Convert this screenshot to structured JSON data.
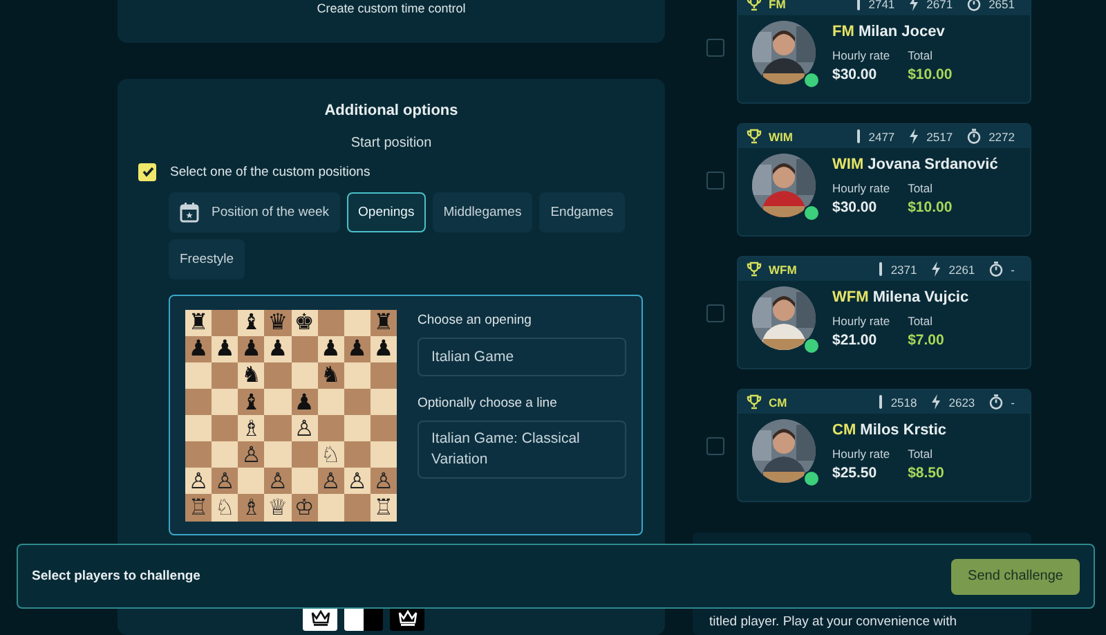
{
  "time_control": {
    "link": "Create custom time control"
  },
  "options": {
    "title": "Additional options",
    "start_position_label": "Start position",
    "custom_positions": {
      "label": "Select one of the custom positions",
      "checked": true
    },
    "categories": [
      {
        "label": "Position of the week",
        "selected": false
      },
      {
        "label": "Openings",
        "selected": true
      },
      {
        "label": "Middlegames",
        "selected": false
      },
      {
        "label": "Endgames",
        "selected": false
      },
      {
        "label": "Freestyle",
        "selected": false
      }
    ],
    "board": [
      "♜ ♝♛♚  ♜",
      "♟♟♟♟ ♟♟♟",
      "  ♞  ♞  ",
      "  ♝ ♟   ",
      "  ♗ ♙   ",
      "  ♙  ♘  ",
      "♙♙ ♙ ♙♙♙",
      "♖♘♗♕♔  ♖"
    ],
    "opening": {
      "label": "Choose an opening",
      "value": "Italian Game"
    },
    "line": {
      "label": "Optionally choose a line",
      "value": "Italian Game: Classical Variation"
    }
  },
  "players": [
    {
      "badge": "FM",
      "bullet": "2741",
      "blitz": "2671",
      "rapid": "2651",
      "title": "FM",
      "name": "Milan Jocev",
      "rate_label": "Hourly rate",
      "rate": "$30.00",
      "total_label": "Total",
      "total": "$10.00",
      "online": true,
      "selected": false
    },
    {
      "badge": "WIM",
      "bullet": "2477",
      "blitz": "2517",
      "rapid": "2272",
      "title": "WIM",
      "name": "Jovana Srdanović",
      "rate_label": "Hourly rate",
      "rate": "$30.00",
      "total_label": "Total",
      "total": "$10.00",
      "online": true,
      "selected": false
    },
    {
      "badge": "WFM",
      "bullet": "2371",
      "blitz": "2261",
      "rapid": "-",
      "title": "WFM",
      "name": "Milena Vujcic",
      "rate_label": "Hourly rate",
      "rate": "$21.00",
      "total_label": "Total",
      "total": "$7.00",
      "online": true,
      "selected": false
    },
    {
      "badge": "CM",
      "bullet": "2518",
      "blitz": "2623",
      "rapid": "-",
      "title": "CM",
      "name": "Milos Krstic",
      "rate_label": "Hourly rate",
      "rate": "$25.50",
      "total_label": "Total",
      "total": "$8.50",
      "online": true,
      "selected": false
    }
  ],
  "info_text": "titled player. Play at your convenience with",
  "challenge_bar": {
    "label": "Select players to challenge",
    "button": "Send challenge"
  }
}
